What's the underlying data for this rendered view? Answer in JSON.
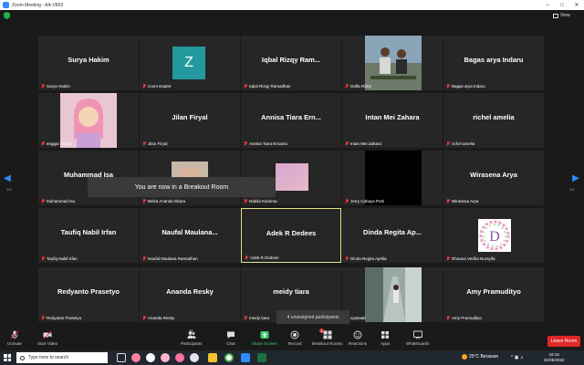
{
  "window": {
    "title": "Zoom Meeting - AA-V803"
  },
  "view_label": "View",
  "pages": {
    "left": "1/2",
    "right": "1/2"
  },
  "toast": "You are now in a Breakout Room",
  "unassigned": "4 unassigned participants",
  "tiles": [
    {
      "big": "Surya Hakim",
      "footer": "Surya Hakim"
    },
    {
      "big": "",
      "footer": "zoom Eaa04",
      "avatar_letter": "Z"
    },
    {
      "big": "Iqbal Rizqy Ram...",
      "footer": "Iqbal Rizqy Ramadhan"
    },
    {
      "big": "",
      "footer": "Daffa Rizky"
    },
    {
      "big": "Bagas arya Indaru",
      "footer": "Bagas arya Indaru"
    },
    {
      "big": "",
      "footer": "enggar ardiyo"
    },
    {
      "big": "Jilan Firyal",
      "footer": "Jilan Firyal"
    },
    {
      "big": "Annisa Tiara Ern...",
      "footer": "Annisa Tiara Ernanto"
    },
    {
      "big": "Intan Mei Zahara",
      "footer": "Intan Mei Zahara"
    },
    {
      "big": "richel amelia",
      "footer": "richel amelia"
    },
    {
      "big": "Muhammad Isa",
      "footer": "Muhammad Isa"
    },
    {
      "big": "",
      "footer": "Belva Ananda Shara"
    },
    {
      "big": "",
      "footer": "Nabila Karisma"
    },
    {
      "big": "",
      "footer": "Jerry Cahaya Putri"
    },
    {
      "big": "Wirasena Arya",
      "footer": "Wirasena Arya"
    },
    {
      "big": "Taufiq Nabil Irfan",
      "footer": "Taufiq Nabil Irfan"
    },
    {
      "big": "Naufal Maulana...",
      "footer": "Naufal Maulana Ramadhan"
    },
    {
      "big": "Adek R Dedees",
      "footer": "Adek R Dedees"
    },
    {
      "big": "Dinda Regita Ap...",
      "footer": "Dinda Regita Aprilia"
    },
    {
      "big": "",
      "footer": "Dheana Vedha Nursyifa",
      "avatar_letter": "D"
    },
    {
      "big": "Redyanto Prasetyo",
      "footer": "Redyanto Prasetyo"
    },
    {
      "big": "Ananda Resky",
      "footer": "Ananda Resky"
    },
    {
      "big": "meidy tiara",
      "footer": "meidy tiara"
    },
    {
      "big": "",
      "footer": "vyasaati"
    },
    {
      "big": "Amy Pramudityo",
      "footer": "Amy Pramudityo"
    }
  ],
  "toolbar": {
    "unmute": "Unmute",
    "start_video": "Start Video",
    "participants": "Participants",
    "participants_count": "28",
    "chat": "Chat",
    "share_screen": "Share Screen",
    "record": "Record",
    "breakout_rooms": "Breakout Rooms",
    "breakout_badge": "4",
    "reactions": "Reactions",
    "apps": "Apps",
    "whiteboards": "Whiteboards",
    "leave": "Leave Room"
  },
  "taskbar": {
    "search_placeholder": "Type here to search",
    "weather": "25°C Berawan",
    "time": "19:16",
    "date": "31/05/2022"
  },
  "colors": {
    "accent": "#2d8cff",
    "share_green": "#3bd16f",
    "leave_red": "#e02828",
    "active_border": "#e8e38a"
  }
}
